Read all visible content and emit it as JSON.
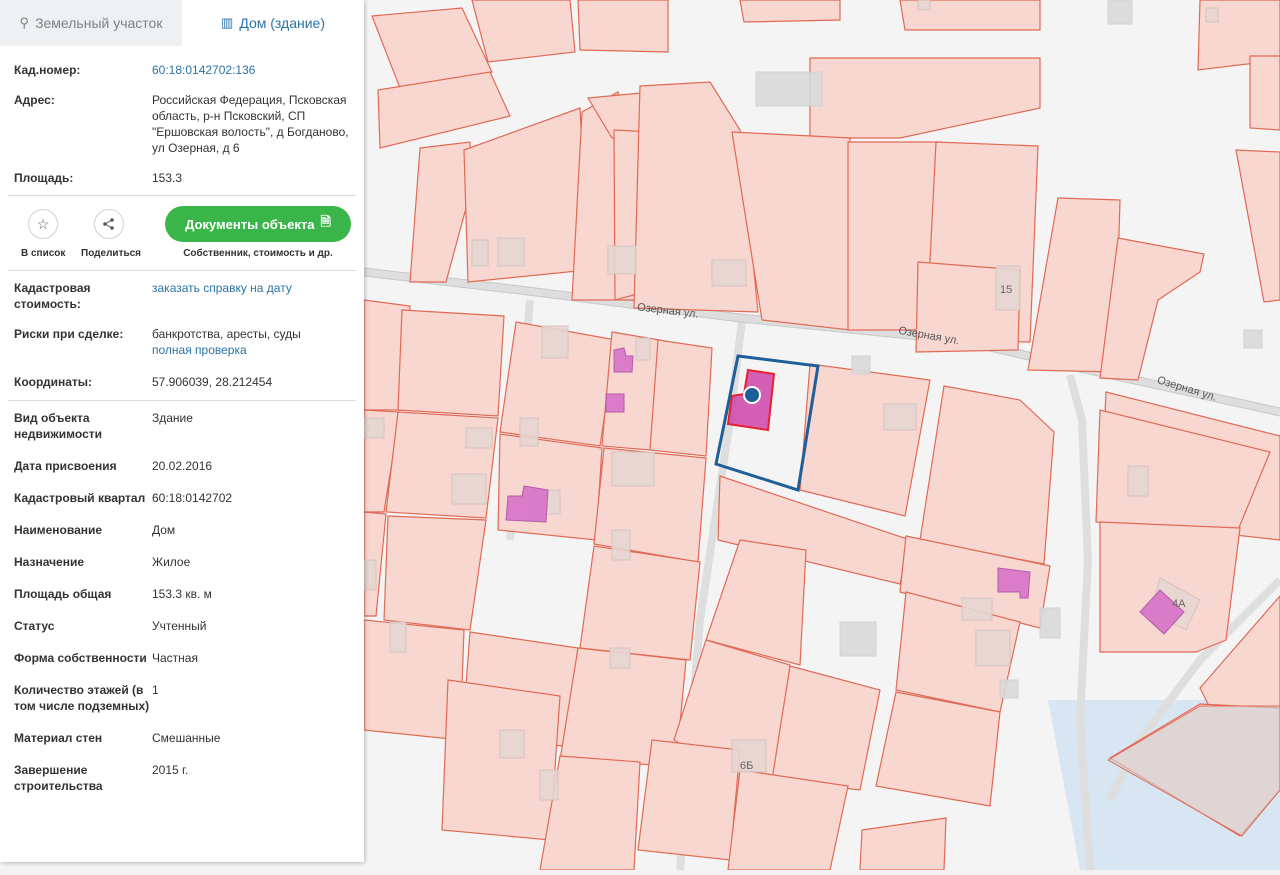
{
  "tabs": [
    {
      "label": "Земельный участок",
      "icon": "map-pin-icon"
    },
    {
      "label": "Дом (здание)",
      "icon": "building-icon"
    }
  ],
  "details_top": {
    "cad_number_label": "Кад.номер:",
    "cad_number_value": "60:18:0142702:136",
    "address_label": "Адрес:",
    "address_value": "Российская Федерация, Псковская область, р-н Псковский, СП \"Ершовская волость\", д Богданово, ул Озерная, д 6",
    "area_label": "Площадь:",
    "area_value": "153.3"
  },
  "actions": {
    "add_to_list_label": "В список",
    "share_label": "Поделиться",
    "documents_button_label": "Документы объекта",
    "documents_sub_label": "Собственник, стоимость и др."
  },
  "details_mid": {
    "cad_cost_label": "Кадастровая стоимость:",
    "cad_cost_link": "заказать справку на дату",
    "risks_label": "Риски при сделке:",
    "risks_value": "банкротства, аресты, суды",
    "risks_link": "полная проверка",
    "coords_label": "Координаты:",
    "coords_value": "57.906039, 28.212454"
  },
  "details_bottom": [
    {
      "label": "Вид объекта недвижимости",
      "value": "Здание"
    },
    {
      "label": "Дата присвоения",
      "value": "20.02.2016"
    },
    {
      "label": "Кадастровый квартал",
      "value": "60:18:0142702"
    },
    {
      "label": "Наименование",
      "value": "Дом"
    },
    {
      "label": "Назначение",
      "value": "Жилое"
    },
    {
      "label": "Площадь общая",
      "value": "153.3 кв. м"
    },
    {
      "label": "Статус",
      "value": "Учтенный"
    },
    {
      "label": "Форма собственности",
      "value": "Частная"
    },
    {
      "label": "Количество этажей (в том числе подземных)",
      "value": "1"
    },
    {
      "label": "Материал стен",
      "value": "Смешанные"
    },
    {
      "label": "Завершение строительства",
      "value": "2015 г."
    }
  ],
  "map": {
    "street_labels": [
      "Озерная ул.",
      "Озерная ул.",
      "Озерная ул."
    ],
    "house_numbers": [
      "15",
      "4А",
      "6Б"
    ],
    "colors": {
      "parcel_fill": "#f8d7d0",
      "parcel_stroke": "#e06a55",
      "selected_parcel_stroke": "#1f5f99",
      "building_fill": "#d773c9",
      "selected_building_fill": "#cc44aa",
      "selected_building_stroke": "#e8202f",
      "marker": "#1f5f99",
      "water": "#d8e6f4"
    }
  }
}
